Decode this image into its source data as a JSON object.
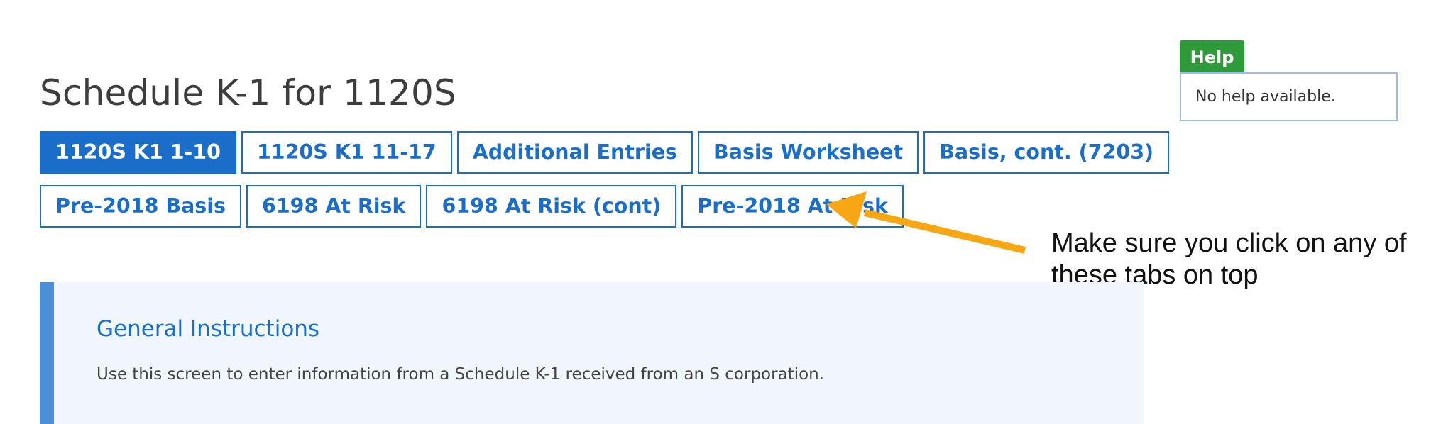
{
  "page": {
    "title": "Schedule K-1 for 1120S"
  },
  "tabs": {
    "row1": [
      {
        "label": "1120S K1 1-10",
        "active": true
      },
      {
        "label": "1120S K1 11-17",
        "active": false
      },
      {
        "label": "Additional Entries",
        "active": false
      },
      {
        "label": "Basis Worksheet",
        "active": false
      },
      {
        "label": "Basis, cont. (7203)",
        "active": false
      }
    ],
    "row2": [
      {
        "label": "Pre-2018 Basis",
        "active": false
      },
      {
        "label": "6198 At Risk",
        "active": false
      },
      {
        "label": "6198 At Risk (cont)",
        "active": false
      },
      {
        "label": "Pre-2018 At Risk",
        "active": false
      }
    ]
  },
  "help": {
    "header": "Help",
    "text": "No help available."
  },
  "annotation": {
    "lines": [
      "Make sure you click on any of",
      "these tabs on top"
    ],
    "arrow_color": "#f7a614"
  },
  "instructions": {
    "heading": "General Instructions",
    "body": "Use this screen to enter information from a Schedule K-1 received from an S corporation."
  },
  "colors": {
    "primary": "#1a6ec9",
    "help_green": "#2f9a3a",
    "panel_bg": "#f0f6fb",
    "panel_accent": "#4a8fd8",
    "arrow": "#f7a614"
  }
}
